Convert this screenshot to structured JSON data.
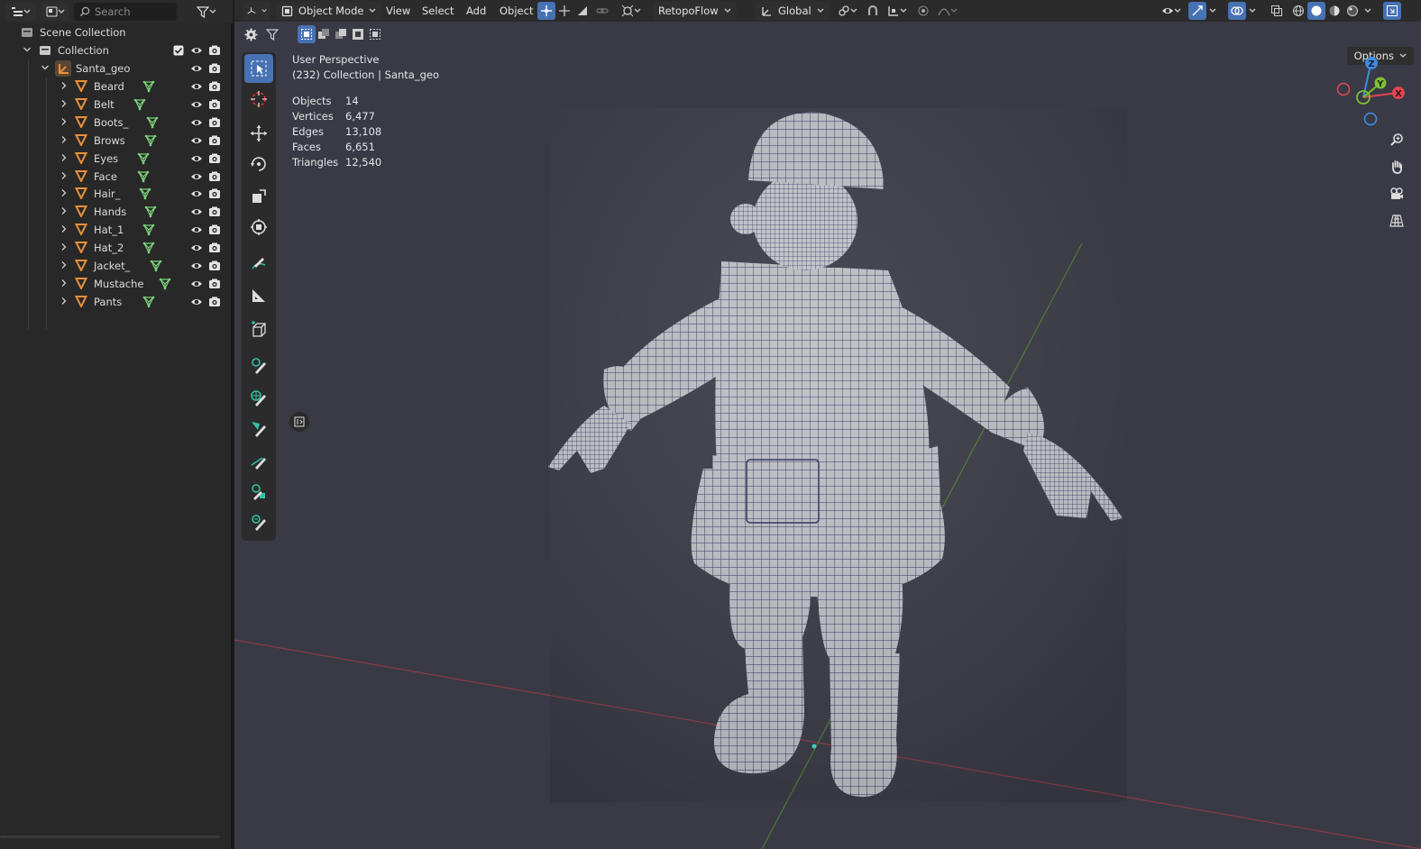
{
  "outliner": {
    "search_placeholder": "Search",
    "scene_collection": "Scene Collection",
    "collection": "Collection",
    "parent_object": "Santa_geo",
    "children": [
      {
        "label": "Beard"
      },
      {
        "label": "Belt"
      },
      {
        "label": "Boots_"
      },
      {
        "label": "Brows"
      },
      {
        "label": "Eyes"
      },
      {
        "label": "Face"
      },
      {
        "label": "Hair_"
      },
      {
        "label": "Hands"
      },
      {
        "label": "Hat_1"
      },
      {
        "label": "Hat_2"
      },
      {
        "label": "Jacket_"
      },
      {
        "label": "Mustache"
      },
      {
        "label": "Pants"
      }
    ]
  },
  "viewport": {
    "mode": "Object Mode",
    "menus": [
      "View",
      "Select",
      "Add",
      "Object"
    ],
    "retopo": "RetopoFlow",
    "transform_orientation": "Global",
    "options_label": "Options",
    "overlay_title": "User Perspective",
    "overlay_context": "(232) Collection | Santa_geo",
    "stats": [
      {
        "key": "Objects",
        "value": "14"
      },
      {
        "key": "Vertices",
        "value": "6,477"
      },
      {
        "key": "Edges",
        "value": "13,108"
      },
      {
        "key": "Faces",
        "value": "6,651"
      },
      {
        "key": "Triangles",
        "value": "12,540"
      }
    ],
    "gizmo": {
      "x": "X",
      "y": "Y",
      "z": "Z"
    }
  },
  "colors": {
    "accent": "#4772b3",
    "mesh_icon": "#e8903a",
    "data_icon": "#7cd27a",
    "x_axis": "#e04552",
    "y_axis": "#7fbe3a",
    "z_axis": "#3f8de0"
  }
}
